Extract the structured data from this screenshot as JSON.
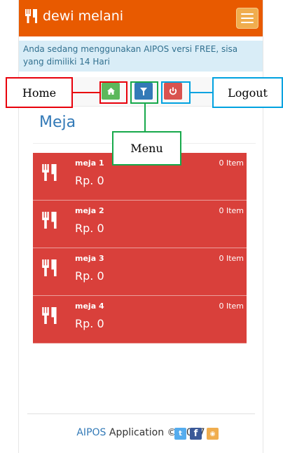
{
  "navbar": {
    "brand": "dewi melani",
    "brand_icon": "cutlery-icon",
    "menu_toggle_icon": "hamburger-icon",
    "bg_color": "#e85a00"
  },
  "alert": {
    "text": "Anda sedang menggunakan AIPOS versi FREE, sisa yang dimiliki 14 Hari"
  },
  "toolbar": {
    "home_icon": "home-icon",
    "menu_icon": "filter-icon",
    "logout_icon": "power-icon"
  },
  "page": {
    "title": "Meja"
  },
  "tables": [
    {
      "name": "meja 1",
      "items": "0 Item",
      "price": "Rp. 0"
    },
    {
      "name": "meja 2",
      "items": "0 Item",
      "price": "Rp. 0"
    },
    {
      "name": "meja 3",
      "items": "0 Item",
      "price": "Rp. 0"
    },
    {
      "name": "meja 4",
      "items": "0 Item",
      "price": "Rp. 0"
    }
  ],
  "footer": {
    "brand": "AIPOS",
    "text": " Application © 2017",
    "social": [
      "twitter-icon",
      "facebook-icon",
      "rss-icon"
    ]
  },
  "annotations": {
    "home": "Home",
    "menu": "Menu",
    "logout": "Logout"
  }
}
